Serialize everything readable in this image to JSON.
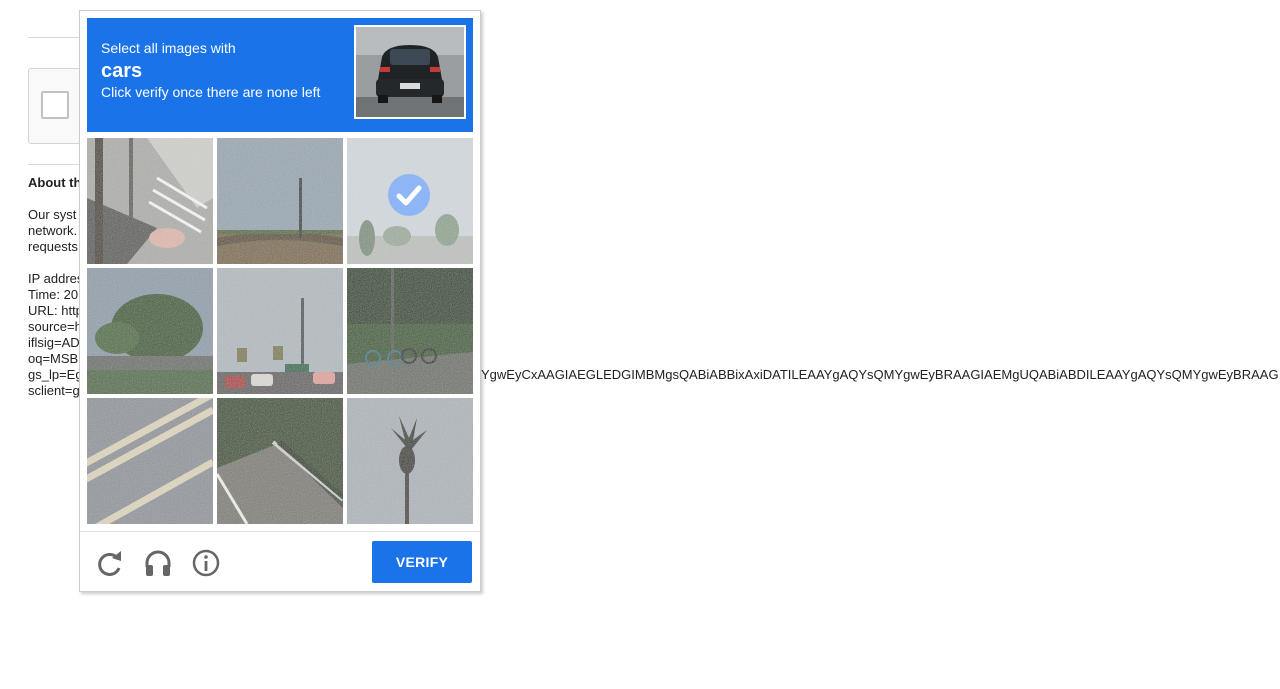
{
  "background_page": {
    "about_heading": "About th",
    "paragraph_lines": [
      "Our syst",
      "network.",
      "requests"
    ],
    "info_lines": [
      "IP addres",
      "Time: 20",
      "URL: http",
      "source=h",
      "iflsig=AD",
      "oq=MSB",
      "gs_lp=Eg",
      "sclient=g"
    ],
    "gs_lp_tail": "YgwEyCxAAGIAEGLEDGIMBMgsQABiABBixAxiDATILEAAYgAQYsQMYgwEyBRAAGIAEMgUQABiABDILEAAYgAQYsQMYgwEyBRAAG"
  },
  "captcha": {
    "prompt_line1": "Select all images with",
    "target_object": "cars",
    "prompt_line2": "Click verify once there are none left",
    "sample_image_icon": "car-rear-photo",
    "tiles": [
      {
        "id": "tile-1",
        "scene": "crosswalk-tree",
        "selected": false
      },
      {
        "id": "tile-2",
        "scene": "pole-bridge",
        "selected": false
      },
      {
        "id": "tile-3",
        "scene": "hazy-trees",
        "selected": true
      },
      {
        "id": "tile-4",
        "scene": "tree-overpass",
        "selected": false
      },
      {
        "id": "tile-5",
        "scene": "traffic-cars",
        "selected": false
      },
      {
        "id": "tile-6",
        "scene": "bicycles-grass",
        "selected": false
      },
      {
        "id": "tile-7",
        "scene": "road-lines",
        "selected": false
      },
      {
        "id": "tile-8",
        "scene": "road-guardrail",
        "selected": false
      },
      {
        "id": "tile-9",
        "scene": "palm-tree",
        "selected": false
      }
    ],
    "reload_icon": "reload-icon",
    "audio_icon": "headphones-icon",
    "info_icon": "info-icon",
    "verify_label": "VERIFY",
    "accent_color": "#1a73e8"
  }
}
